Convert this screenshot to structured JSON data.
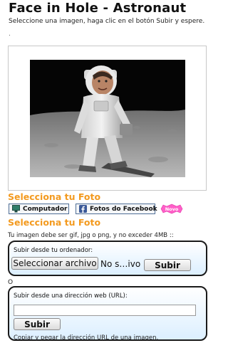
{
  "header": {
    "title": "Face in Hole - Astronaut",
    "subtitle": "Seleccione una imagen, haga clic en el botón Subir y espere.",
    "dot": "."
  },
  "photo": {
    "subject": "astronaut-on-moon"
  },
  "select_photo": {
    "heading": "Selecciona tu Foto",
    "computer_label": "Computador",
    "facebook_label": "Fotos do Facebook",
    "new_badge": "Novo"
  },
  "upload": {
    "heading": "Selecciona tu Foto",
    "note": "Tu imagen debe ser gif, jpg o png, y no exceder 4MB ::",
    "local": {
      "label": "Subir desde tu ordenador:",
      "choose_button": "Seleccionar archivo",
      "file_status": "No s…ivo",
      "submit_button": "Subir"
    },
    "separator": "O",
    "url": {
      "label": "Subir desde una dirección web (URL):",
      "input_value": "",
      "submit_button": "Subir",
      "help": "Copiar y pegar la dirección URL de una imagen."
    }
  },
  "colors": {
    "accent_orange": "#f39a1f",
    "facebook_blue": "#3b5998",
    "badge_pink": "#ff5fc8"
  }
}
